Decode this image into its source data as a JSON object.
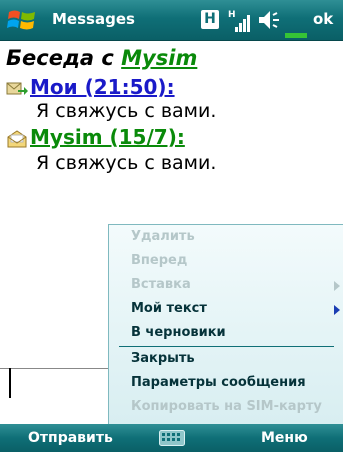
{
  "titlebar": {
    "title": "Messages",
    "h_icon_label": "H",
    "ok_label": "ok"
  },
  "conversation": {
    "header_prefix": "Беседа с ",
    "contact_name": "Mysim",
    "messages": [
      {
        "header": "Мои (21:50):",
        "text": "Я свяжусь с вами.",
        "color": "#1a1ac8"
      },
      {
        "header": "Mysim (15/7):",
        "text": "Я свяжусь с вами.",
        "color": "#0a8a0a"
      }
    ]
  },
  "menu": {
    "items": [
      {
        "label": "Удалить",
        "enabled": false
      },
      {
        "label": "Вперед",
        "enabled": false
      },
      {
        "label": "Вставка",
        "enabled": false,
        "submenu": true
      },
      {
        "label": "Мой текст",
        "enabled": true,
        "submenu": true
      },
      {
        "label": "В черновики",
        "enabled": true
      },
      {
        "label": "Закрыть",
        "enabled": true
      },
      {
        "label": "Параметры сообщения",
        "enabled": true
      },
      {
        "label": "Копировать на SIM-карту",
        "enabled": false
      }
    ]
  },
  "softkeys": {
    "left": "Отправить",
    "right": "Меню"
  },
  "colors": {
    "bar": "#0f6f77",
    "accent_green": "#36c436",
    "disabled": "#b5c7c9"
  },
  "icons": [
    "windows-start-icon",
    "network-h-icon",
    "signal-icon",
    "volume-icon",
    "sent-message-icon",
    "received-message-icon",
    "keyboard-icon"
  ]
}
